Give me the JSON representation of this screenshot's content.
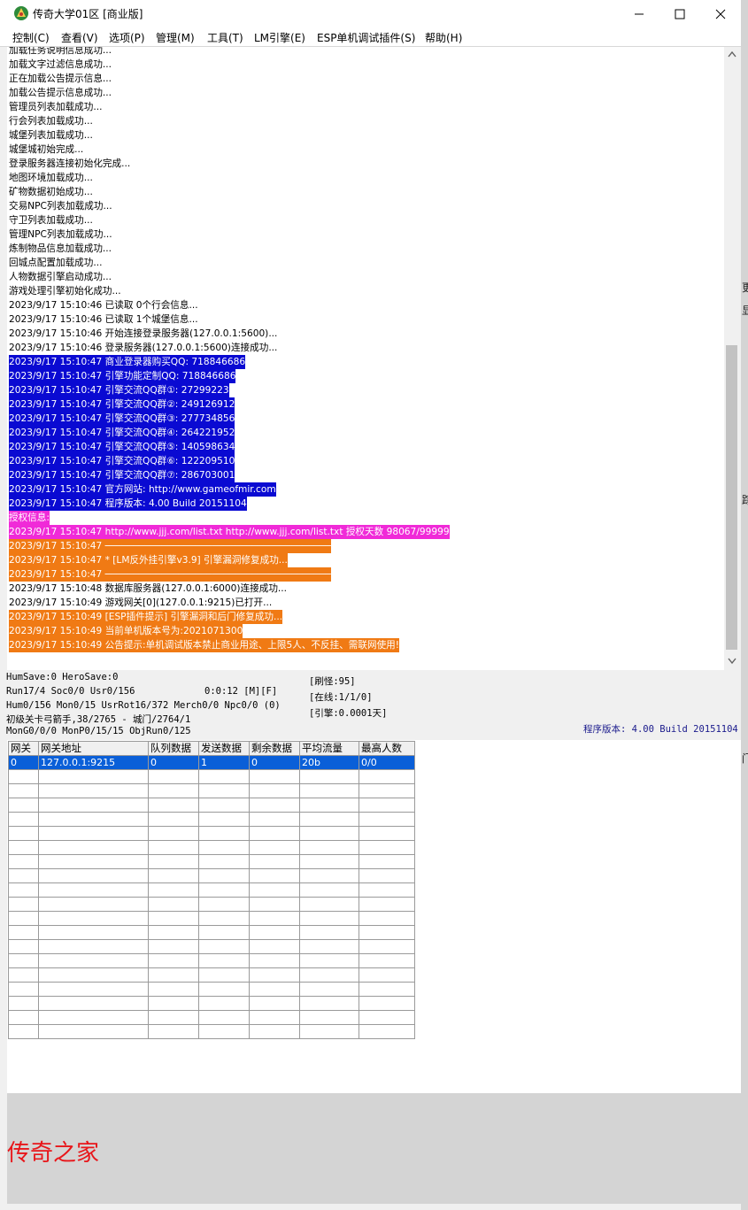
{
  "window": {
    "title": "传奇大学01区 [商业版]"
  },
  "menu": [
    "控制(C)",
    "查看(V)",
    "选项(P)",
    "管理(M)",
    "工具(T)",
    "LM引擎(E)",
    "ESP单机调试插件(S)",
    "帮助(H)"
  ],
  "colors": {
    "blue": "#0a0ad2",
    "pink": "#f02ad8",
    "orange": "#f07a14",
    "select": "#0a5fd8",
    "watermark": "#e8161a"
  },
  "log": [
    {
      "text": "加载任务说明信息成功...",
      "style": "plain"
    },
    {
      "text": "加载文字过滤信息成功...",
      "style": "plain"
    },
    {
      "text": "正在加载公告提示信息...",
      "style": "plain"
    },
    {
      "text": "加载公告提示信息成功...",
      "style": "plain"
    },
    {
      "text": "管理员列表加载成功...",
      "style": "plain"
    },
    {
      "text": "行会列表加载成功...",
      "style": "plain"
    },
    {
      "text": "城堡列表加载成功...",
      "style": "plain"
    },
    {
      "text": "城堡城初始完成...",
      "style": "plain"
    },
    {
      "text": "登录服务器连接初始化完成...",
      "style": "plain"
    },
    {
      "text": "地图环境加载成功...",
      "style": "plain"
    },
    {
      "text": "矿物数据初始成功...",
      "style": "plain"
    },
    {
      "text": "交易NPC列表加载成功...",
      "style": "plain"
    },
    {
      "text": "守卫列表加载成功...",
      "style": "plain"
    },
    {
      "text": "管理NPC列表加载成功...",
      "style": "plain"
    },
    {
      "text": "炼制物品信息加载成功...",
      "style": "plain"
    },
    {
      "text": "回城点配置加载成功...",
      "style": "plain"
    },
    {
      "text": "人物数据引擎启动成功...",
      "style": "plain"
    },
    {
      "text": "游戏处理引擎初始化成功...",
      "style": "plain"
    },
    {
      "text": "2023/9/17 15:10:46 已读取 0个行会信息...",
      "style": "plain"
    },
    {
      "text": "2023/9/17 15:10:46 已读取 1个城堡信息...",
      "style": "plain"
    },
    {
      "text": "2023/9/17 15:10:46 开始连接登录服务器(127.0.0.1:5600)...",
      "style": "plain"
    },
    {
      "text": "2023/9/17 15:10:46 登录服务器(127.0.0.1:5600)连接成功...",
      "style": "plain"
    },
    {
      "text": "2023/9/17 15:10:47 商业登录器购买QQ: 718846686",
      "style": "blue"
    },
    {
      "text": "2023/9/17 15:10:47 引擎功能定制QQ: 718846686",
      "style": "blue"
    },
    {
      "text": "2023/9/17 15:10:47 引擎交流QQ群①: 27299223",
      "style": "blue"
    },
    {
      "text": "2023/9/17 15:10:47 引擎交流QQ群②: 249126912",
      "style": "blue"
    },
    {
      "text": "2023/9/17 15:10:47 引擎交流QQ群③: 277734856",
      "style": "blue"
    },
    {
      "text": "2023/9/17 15:10:47 引擎交流QQ群④: 264221952",
      "style": "blue"
    },
    {
      "text": "2023/9/17 15:10:47 引擎交流QQ群⑤: 140598634",
      "style": "blue"
    },
    {
      "text": "2023/9/17 15:10:47 引擎交流QQ群⑥: 122209510",
      "style": "blue"
    },
    {
      "text": "2023/9/17 15:10:47 引擎交流QQ群⑦: 286703001",
      "style": "blue"
    },
    {
      "text": "2023/9/17 15:10:47 官方网站: http://www.gameofmir.com",
      "style": "blue"
    },
    {
      "text": "2023/9/17 15:10:47 程序版本: 4.00 Build 20151104",
      "style": "blue"
    },
    {
      "text": "授权信息:",
      "style": "pink"
    },
    {
      "text": "2023/9/17 15:10:47 http://www.jjj.com/list.txt http://www.jjj.com/list.txt 授权天数 98067/99999",
      "style": "pink"
    },
    {
      "text": "2023/9/17 15:10:47 ────────────────────────────────────────",
      "style": "orange"
    },
    {
      "text": "2023/9/17 15:10:47 * [LM反外挂引擎v3.9] 引擎漏洞修复成功...",
      "style": "orange"
    },
    {
      "text": "2023/9/17 15:10:47 ────────────────────────────────────────",
      "style": "orange"
    },
    {
      "text": "2023/9/17 15:10:48 数据库服务器(127.0.0.1:6000)连接成功...",
      "style": "plain"
    },
    {
      "text": "2023/9/17 15:10:49 游戏网关[0](127.0.0.1:9215)已打开...",
      "style": "plain"
    },
    {
      "text": "2023/9/17 15:10:49 [ESP插件提示] 引擎漏洞和后门修复成功...",
      "style": "orange"
    },
    {
      "text": "2023/9/17 15:10:49 当前单机版本号为:2021071300",
      "style": "orange"
    },
    {
      "text": "2023/9/17 15:10:49 公告提示:单机调试版本禁止商业用途、上限5人、不反挂、需联网使用!",
      "style": "orange"
    }
  ],
  "status": {
    "line1": "HumSave:0 HeroSave:0",
    "line2": "Run17/4 Soc0/0 Usr0/156",
    "line2b": "0:0:12 [M][F]",
    "line3": "Hum0/156 Mon0/15 UsrRot16/372 Merch0/0 Npc0/0 (0)",
    "line4": "初级关卡弓箭手,38/2765 - 城门/2764/1",
    "line5": "MonG0/0/0 MonP0/15/15 ObjRun0/125",
    "refresh": "[刷怪:95]",
    "online": "[在线:1/1/0]",
    "engine": "[引擎:0.0001天]",
    "version": "程序版本: 4.00 Build 20151104"
  },
  "grid": {
    "headers": [
      "网关",
      "网关地址",
      "队列数据",
      "发送数据",
      "剩余数据",
      "平均流量",
      "最高人数"
    ],
    "rows": [
      [
        "0",
        "127.0.0.1:9215",
        "0",
        "1",
        "0",
        "20b",
        "0/0"
      ]
    ]
  },
  "watermark": "传奇之家"
}
